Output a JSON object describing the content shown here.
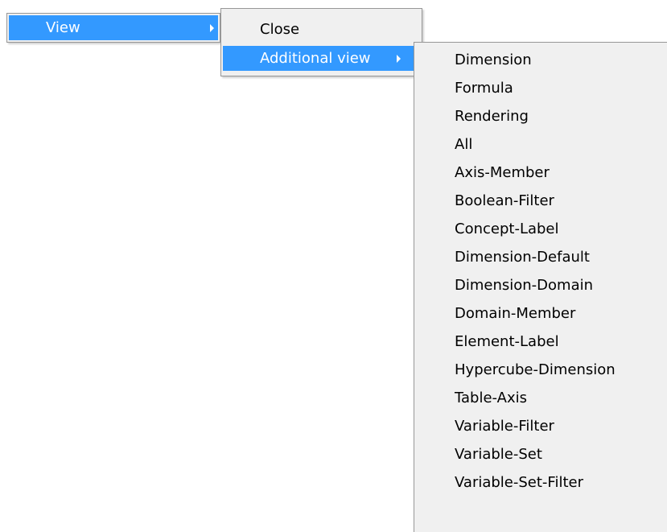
{
  "menu1": {
    "items": [
      {
        "label": "View",
        "has_submenu": true,
        "highlighted": true
      }
    ]
  },
  "menu2": {
    "items": [
      {
        "label": "Close",
        "has_submenu": false,
        "highlighted": false
      },
      {
        "label": "Additional view",
        "has_submenu": true,
        "highlighted": true
      }
    ]
  },
  "menu3": {
    "items": [
      {
        "label": "Dimension"
      },
      {
        "label": "Formula"
      },
      {
        "label": "Rendering"
      },
      {
        "label": "All"
      },
      {
        "label": "Axis-Member"
      },
      {
        "label": "Boolean-Filter"
      },
      {
        "label": "Concept-Label"
      },
      {
        "label": "Dimension-Default"
      },
      {
        "label": "Dimension-Domain"
      },
      {
        "label": "Domain-Member"
      },
      {
        "label": "Element-Label"
      },
      {
        "label": "Hypercube-Dimension"
      },
      {
        "label": "Table-Axis"
      },
      {
        "label": "Variable-Filter"
      },
      {
        "label": "Variable-Set"
      },
      {
        "label": "Variable-Set-Filter"
      }
    ]
  },
  "colors": {
    "highlight": "#3399ff",
    "menu_background": "#f0f0f0",
    "border": "#979797"
  }
}
